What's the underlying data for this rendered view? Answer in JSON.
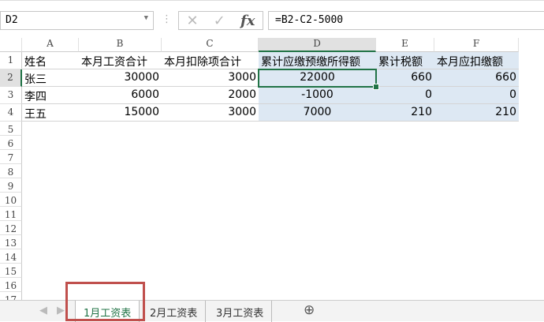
{
  "name_box": "D2",
  "formula": "=B2-C2-5000",
  "columns": [
    "A",
    "B",
    "C",
    "D",
    "E",
    "F"
  ],
  "row_numbers": [
    "1",
    "2",
    "3",
    "4",
    "5",
    "6",
    "7",
    "8",
    "9",
    "10",
    "11",
    "12",
    "13",
    "14",
    "15",
    "16",
    "17"
  ],
  "rows": [
    [
      "姓名",
      "本月工资合计",
      "本月扣除项合计",
      "累计应缴预缴所得额",
      "累计税额",
      "本月应扣缴额"
    ],
    [
      "张三",
      "30000",
      "3000",
      "22000",
      "660",
      "660"
    ],
    [
      "李四",
      "6000",
      "2000",
      "-1000",
      "0",
      "0"
    ],
    [
      "王五",
      "15000",
      "3000",
      "7000",
      "210",
      "210"
    ]
  ],
  "sheet_tabs": [
    "1月工资表",
    "2月工资表",
    "3月工资表"
  ],
  "active_tab": "1月工资表",
  "icons": {
    "cancel": "✕",
    "enter": "✓",
    "fx": "fx",
    "add_sheet": "⊕",
    "prev": "◀",
    "next": "▶"
  }
}
